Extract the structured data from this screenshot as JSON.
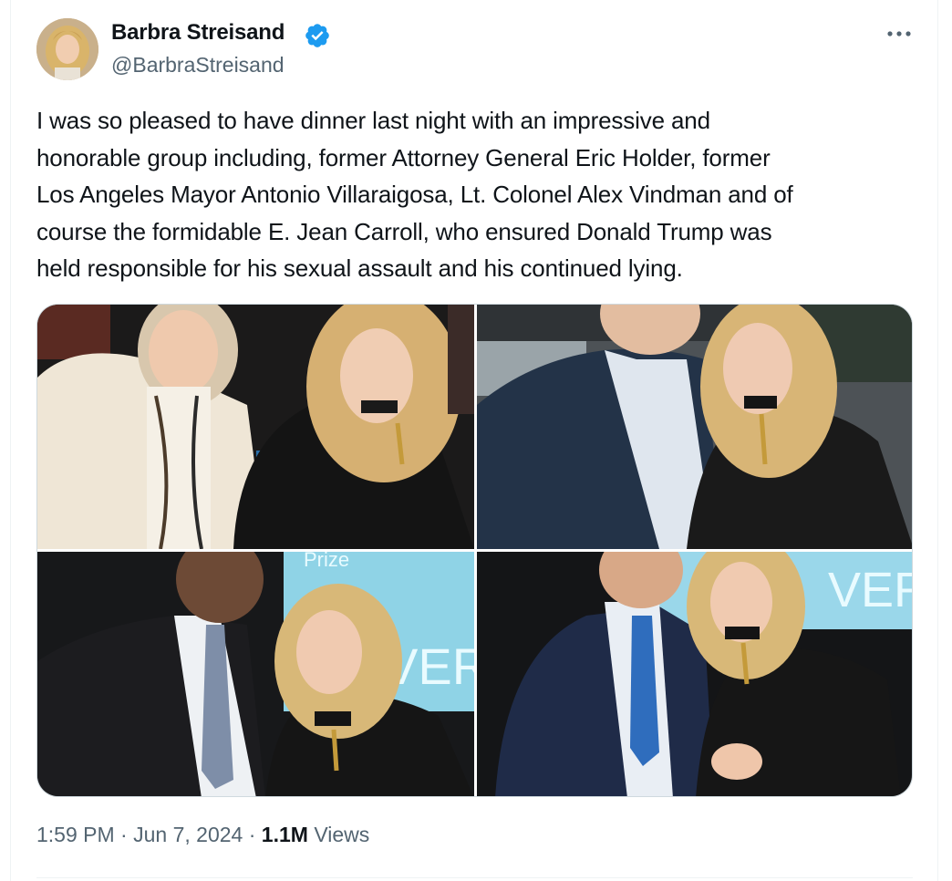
{
  "author": {
    "display_name": "Barbra Streisand",
    "handle": "@BarbraStreisand",
    "verified": true,
    "avatar_icon": "profile-photo",
    "verified_icon": "verified-badge-icon",
    "verified_color": "#1d9bf0"
  },
  "menu": {
    "icon": "more-options-icon"
  },
  "tweet": {
    "text_lines": [
      "I was so pleased to have dinner last night with an impressive and",
      "honorable group including, former Attorney General Eric Holder, former",
      "Los Angeles Mayor Antonio Villaraigosa, Lt. Colonel Alex Vindman and of",
      "course the formidable E. Jean Carroll, who ensured Donald Trump was",
      "held responsible for his sexual assault and his continued lying."
    ],
    "photos": [
      {
        "name": "photo-1",
        "caption_text": ""
      },
      {
        "name": "photo-2",
        "caption_text": ""
      },
      {
        "name": "photo-3",
        "caption_text": "Prize VER"
      },
      {
        "name": "photo-4",
        "caption_text": "VERS"
      }
    ]
  },
  "meta": {
    "time": "1:59 PM",
    "separator": "·",
    "date": "Jun 7, 2024",
    "views_count": "1.1M",
    "views_label": "Views"
  },
  "colors": {
    "text_primary": "#0f1419",
    "text_secondary": "#536471",
    "border": "#cfd9de"
  }
}
